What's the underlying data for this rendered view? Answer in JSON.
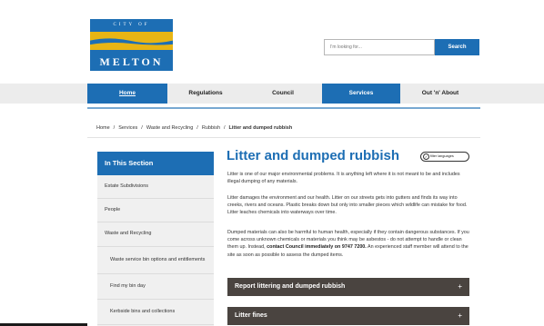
{
  "logo": {
    "top_text": "CITY OF",
    "name": "MELTON"
  },
  "search": {
    "placeholder": "I'm looking for...",
    "button_label": "Search"
  },
  "nav": {
    "items": [
      {
        "label": "Home"
      },
      {
        "label": "Regulations"
      },
      {
        "label": "Council"
      },
      {
        "label": "Services"
      },
      {
        "label": "Out 'n' About"
      }
    ]
  },
  "breadcrumb": {
    "items": [
      "Home",
      "Services",
      "Waste and Recycling",
      "Rubbish"
    ],
    "current": "Litter and dumped rubbish",
    "separator": "/"
  },
  "sidebar": {
    "heading": "In This Section",
    "items": [
      {
        "label": "Estate Subdivisions"
      },
      {
        "label": "People"
      },
      {
        "label": "Waste and Recycling"
      },
      {
        "label": "Waste service bin options and entitlements"
      },
      {
        "label": "Find my bin day"
      },
      {
        "label": "Kerbside bins and collections"
      }
    ]
  },
  "main": {
    "title": "Litter and dumped rubbish",
    "filter_label": "filter languages",
    "paragraphs": [
      "Litter is one of our major environmental problems. It is anything left where it is not meant to be and includes illegal dumping of any materials.",
      "Litter damages the environment and our health. Litter on our streets gets into gutters and finds its way into creeks, rivers and oceans. Plastic breaks down but only into smaller pieces which wildlife can mistake for food. Litter leaches chemicals into waterways over time."
    ],
    "para3_before": "Dumped materials can also be harmful to human health, especially if they contain dangerous substances. If you come across unknown chemicals or materials you think may be asbestos - do not attempt to handle or clean them up. Instead, ",
    "para3_bold": "contact Council immediately on 9747 7200.",
    "para3_after": " An experienced staff member will attend to the site as soon as possible to assess the dumped items.",
    "accordions": [
      {
        "label": "Report littering and dumped rubbish",
        "icon": "+"
      },
      {
        "label": "Litter fines",
        "icon": "+"
      }
    ]
  },
  "colors": {
    "brand_blue": "#1d6eb4",
    "logo_gold": "#e8b514",
    "accordion_bg": "#4a4440"
  }
}
